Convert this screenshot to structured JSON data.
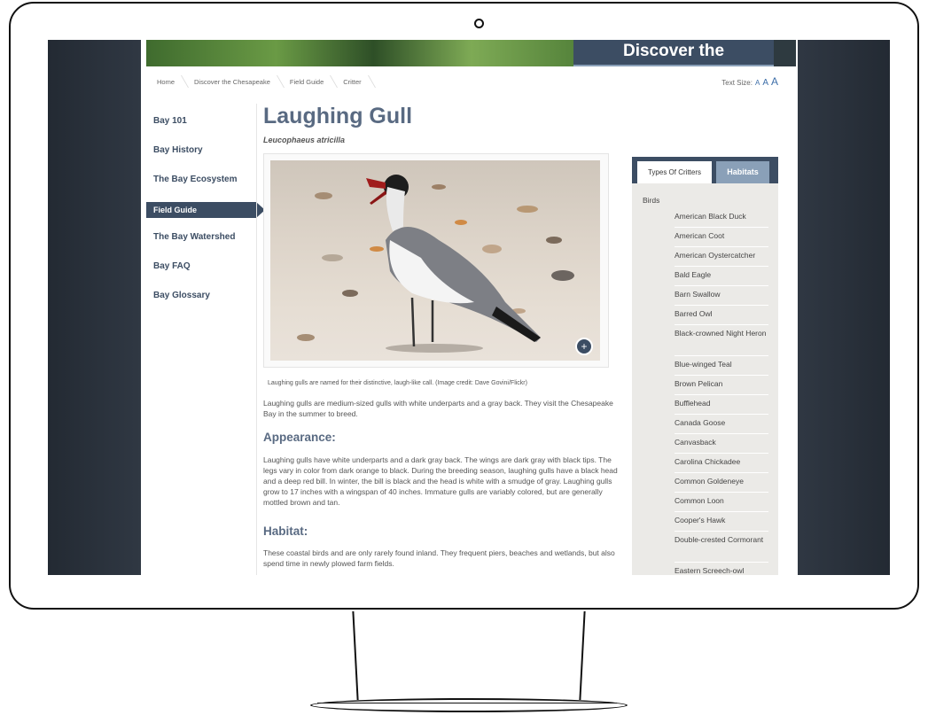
{
  "banner": {
    "title": "Discover the Chesapeake"
  },
  "breadcrumbs": [
    "Home",
    "Discover the Chesapeake",
    "Field Guide",
    "Critter"
  ],
  "text_size": {
    "label": "Text Size:",
    "a1": "A",
    "a2": "A",
    "a3": "A"
  },
  "nav": {
    "items": [
      "Bay 101",
      "Bay History",
      "The Bay Ecosystem",
      "Field Guide",
      "The Bay Watershed",
      "Bay FAQ",
      "Bay Glossary"
    ],
    "active": "Field Guide"
  },
  "article": {
    "title": "Laughing Gull",
    "scientific_name": "Leucophaeus atricilla",
    "caption": "Laughing gulls are named for their distinctive, laugh-like call. (Image credit: Dave Govini/Flickr)",
    "intro": "Laughing gulls are medium-sized gulls with white underparts and a gray back. They visit the Chesapeake Bay in the summer to breed.",
    "sections": [
      {
        "heading": "Appearance:",
        "text": "Laughing gulls have white underparts and a dark gray back. The wings are dark gray with black tips. The legs vary in color from dark orange to black. During the breeding season, laughing gulls have a black head and a deep red bill. In winter, the bill is black and the head is white with a smudge of gray. Laughing gulls grow to 17 inches with a wingspan of 40 inches. Immature gulls are variably colored, but are generally mottled brown and tan."
      },
      {
        "heading": "Habitat:",
        "text": "These coastal birds and are only rarely found inland. They frequent piers, beaches and wetlands, but also spend time in newly plowed farm fields."
      }
    ]
  },
  "sidebar": {
    "tabs": [
      "Types Of Critters",
      "Habitats"
    ],
    "category": "Birds",
    "items": [
      "American Black Duck",
      "American Coot",
      "American Oystercatcher",
      "Bald Eagle",
      "Barn Swallow",
      "Barred Owl",
      "Black-crowned Night Heron",
      "Blue-winged Teal",
      "Brown Pelican",
      "Bufflehead",
      "Canada Goose",
      "Canvasback",
      "Carolina Chickadee",
      "Common Goldeneye",
      "Common Loon",
      "Cooper's Hawk",
      "Double-crested Cormorant",
      "Eastern Screech-owl"
    ]
  },
  "colors": {
    "accent": "#3c4d63",
    "heading": "#596a82"
  }
}
